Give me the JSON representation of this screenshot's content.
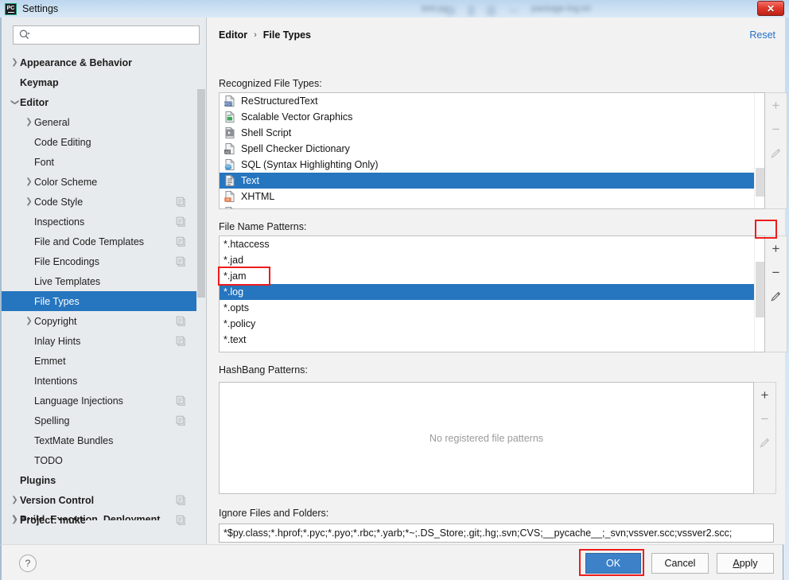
{
  "window": {
    "title": "Settings",
    "app_icon": "pycharm-pc-icon",
    "close_label": "✕",
    "bg_tab_1": "test.py",
    "bg_tab_2": "package-log.txt"
  },
  "search": {
    "value": "",
    "placeholder": "",
    "icon": "search-icon"
  },
  "sidebar": {
    "items": [
      {
        "label": "Appearance & Behavior",
        "level": 1,
        "group": true,
        "arrow": "collapsed",
        "config": false,
        "selected": false
      },
      {
        "label": "Keymap",
        "level": 1,
        "group": true,
        "arrow": "none",
        "config": false,
        "selected": false
      },
      {
        "label": "Editor",
        "level": 1,
        "group": true,
        "arrow": "expanded",
        "config": false,
        "selected": false
      },
      {
        "label": "General",
        "level": 2,
        "group": false,
        "arrow": "collapsed",
        "config": false,
        "selected": false
      },
      {
        "label": "Code Editing",
        "level": 2,
        "group": false,
        "arrow": "none",
        "config": false,
        "selected": false
      },
      {
        "label": "Font",
        "level": 2,
        "group": false,
        "arrow": "none",
        "config": false,
        "selected": false
      },
      {
        "label": "Color Scheme",
        "level": 2,
        "group": false,
        "arrow": "collapsed",
        "config": false,
        "selected": false
      },
      {
        "label": "Code Style",
        "level": 2,
        "group": false,
        "arrow": "collapsed",
        "config": true,
        "selected": false
      },
      {
        "label": "Inspections",
        "level": 2,
        "group": false,
        "arrow": "none",
        "config": true,
        "selected": false
      },
      {
        "label": "File and Code Templates",
        "level": 2,
        "group": false,
        "arrow": "none",
        "config": true,
        "selected": false
      },
      {
        "label": "File Encodings",
        "level": 2,
        "group": false,
        "arrow": "none",
        "config": true,
        "selected": false
      },
      {
        "label": "Live Templates",
        "level": 2,
        "group": false,
        "arrow": "none",
        "config": false,
        "selected": false
      },
      {
        "label": "File Types",
        "level": 2,
        "group": false,
        "arrow": "none",
        "config": false,
        "selected": true
      },
      {
        "label": "Copyright",
        "level": 2,
        "group": false,
        "arrow": "collapsed",
        "config": true,
        "selected": false
      },
      {
        "label": "Inlay Hints",
        "level": 2,
        "group": false,
        "arrow": "none",
        "config": true,
        "selected": false
      },
      {
        "label": "Emmet",
        "level": 2,
        "group": false,
        "arrow": "none",
        "config": false,
        "selected": false
      },
      {
        "label": "Intentions",
        "level": 2,
        "group": false,
        "arrow": "none",
        "config": false,
        "selected": false
      },
      {
        "label": "Language Injections",
        "level": 2,
        "group": false,
        "arrow": "none",
        "config": true,
        "selected": false
      },
      {
        "label": "Spelling",
        "level": 2,
        "group": false,
        "arrow": "none",
        "config": true,
        "selected": false
      },
      {
        "label": "TextMate Bundles",
        "level": 2,
        "group": false,
        "arrow": "none",
        "config": false,
        "selected": false
      },
      {
        "label": "TODO",
        "level": 2,
        "group": false,
        "arrow": "none",
        "config": false,
        "selected": false
      },
      {
        "label": "Plugins",
        "level": 1,
        "group": true,
        "arrow": "none",
        "config": false,
        "selected": false
      },
      {
        "label": "Version Control",
        "level": 1,
        "group": true,
        "arrow": "collapsed",
        "config": true,
        "selected": false
      },
      {
        "label": "Project: muke",
        "level": 1,
        "group": true,
        "arrow": "collapsed",
        "config": true,
        "selected": false
      }
    ],
    "clipped_item": "Build, Execution, Deployment"
  },
  "content": {
    "breadcrumb": {
      "parent": "Editor",
      "separator": "›",
      "current": "File Types"
    },
    "reset_label": "Reset",
    "recognized_label": "Recognized File Types:",
    "recognized_types": [
      {
        "name": "ReStructuredText",
        "icon": "rst-file-icon",
        "selected": false
      },
      {
        "name": "Scalable Vector Graphics",
        "icon": "svg-file-icon",
        "selected": false
      },
      {
        "name": "Shell Script",
        "icon": "shell-script-icon",
        "selected": false
      },
      {
        "name": "Spell Checker Dictionary",
        "icon": "dictionary-file-icon",
        "selected": false
      },
      {
        "name": "SQL (Syntax Highlighting Only)",
        "icon": "sql-file-icon",
        "selected": false
      },
      {
        "name": "Text",
        "icon": "text-file-icon",
        "selected": true
      },
      {
        "name": "XHTML",
        "icon": "xhtml-file-icon",
        "selected": false
      }
    ],
    "patterns_label": "File Name Patterns:",
    "patterns": [
      {
        "value": "*.htaccess",
        "selected": false
      },
      {
        "value": "*.jad",
        "selected": false
      },
      {
        "value": "*.jam",
        "selected": false
      },
      {
        "value": "*.log",
        "selected": true
      },
      {
        "value": "*.opts",
        "selected": false
      },
      {
        "value": "*.policy",
        "selected": false
      },
      {
        "value": "*.text",
        "selected": false
      }
    ],
    "hashbang_label": "HashBang Patterns:",
    "hashbang_empty": "No registered file patterns",
    "ignore_label": "Ignore Files and Folders:",
    "ignore_value": "*$py.class;*.hprof;*.pyc;*.pyo;*.rbc;*.yarb;*~;.DS_Store;.git;.hg;.svn;CVS;__pycache__;_svn;vssver.scc;vssver2.scc;",
    "toolbar": {
      "add_label": "+",
      "remove_label": "−",
      "edit_label": "edit-pencil-icon"
    }
  },
  "footer": {
    "help_label": "?",
    "ok_label": "OK",
    "cancel_label": "Cancel",
    "apply_label": "Apply",
    "apply_underline_char": "A",
    "apply_rest": "pply"
  },
  "colors": {
    "selection_blue": "#2675bf",
    "primary_button": "#3d82c8",
    "link_blue": "#2470c7",
    "annotation_red": "#ee1c1c"
  }
}
